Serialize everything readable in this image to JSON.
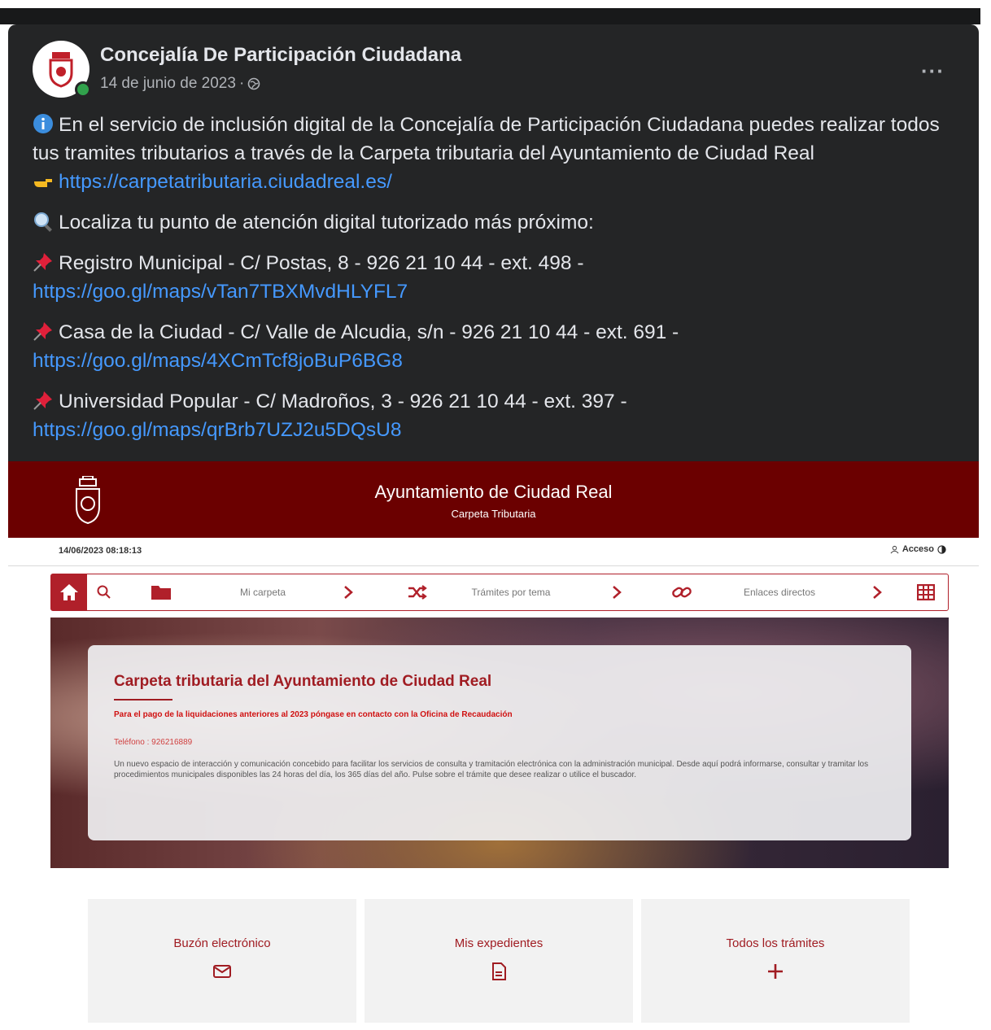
{
  "post": {
    "author": "Concejalía De Participación Ciudadana",
    "date": "14 de junio de 2023",
    "date_sep": "·",
    "more": "···",
    "avatar_icon": "crest-logo-icon",
    "paragraphs": {
      "p1_text": "En el servicio de inclusión digital de la Concejalía de Participación Ciudadana puedes realizar todos tus tramites tributarios a través de la Carpeta tributaria del Ayuntamiento de Ciudad Real",
      "p1_link": "https://carpetatributaria.ciudadreal.es/",
      "p2_text": "Localiza tu punto de atención digital tutorizado más próximo:",
      "p3_text": "Registro Municipal -  C/ Postas, 8 - 926 21 10 44 - ext. 498 -",
      "p3_link": "https://goo.gl/maps/vTan7TBXMvdHLYFL7",
      "p4_text": "Casa de la Ciudad -  C/ Valle de Alcudia, s/n - 926 21 10 44 - ext. 691 -",
      "p4_link": "https://goo.gl/maps/4XCmTcf8joBuP6BG8",
      "p5_text": "Universidad Popular - C/ Madroños, 3 - 926 21 10 44 - ext. 397 -",
      "p5_link": "https://goo.gl/maps/qrBrb7UZJ2u5DQsU8"
    }
  },
  "site": {
    "title": "Ayuntamiento de Ciudad Real",
    "subtitle": "Carpeta  Tributaria",
    "date": "14/06/2023",
    "time": "08:18:13",
    "login": "Acceso",
    "nav": {
      "my_folder": "Mi carpeta",
      "procedures": "Trámites por tema",
      "links": "Enlaces directos"
    },
    "hero": {
      "title": "Carpeta tributaria del Ayuntamiento de Ciudad Real",
      "notice": "Para el pago de la liquidaciones anteriores al 2023 póngase en contacto con la Oficina de Recaudación",
      "phone": "Teléfono : 926216889",
      "description": "Un nuevo espacio de interacción y comunicación concebido para facilitar los servicios de consulta y tramitación electrónica con la administración municipal. Desde aquí podrá informarse, consultar y tramitar los procedimientos municipales disponibles las 24 horas del día, los 365 días del año. Pulse sobre el trámite que desee realizar o utilice el buscador."
    },
    "cards": [
      {
        "label": "Buzón electrónico",
        "icon": "envelope-icon"
      },
      {
        "label": "Mis expedientes",
        "icon": "document-icon"
      },
      {
        "label": "Todos los trámites",
        "icon": "plus-icon"
      }
    ]
  },
  "colors": {
    "fb_bg": "#242526",
    "link": "#4599ff",
    "brand_red": "#6b0000",
    "accent_red": "#b0202a"
  }
}
